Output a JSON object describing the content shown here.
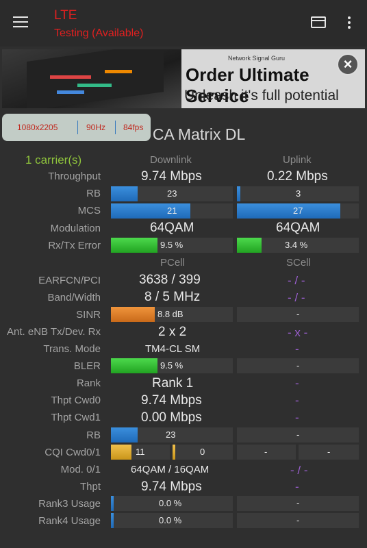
{
  "app": {
    "title": "LTE",
    "subtitle": "Testing (Available)"
  },
  "ad": {
    "brand": "Network Signal Guru",
    "headline": "Order Ultimate Service",
    "tagline": "Unleash it's full potential"
  },
  "overlay": {
    "resolution": "1080x2205",
    "refresh": "90Hz",
    "fps": "84fps"
  },
  "section_title": "LTE CA Matrix DL",
  "carriers": "1 carrier(s)",
  "headers": {
    "downlink": "Downlink",
    "uplink": "Uplink",
    "pcell": "PCell",
    "scell": "SCell"
  },
  "labels": {
    "throughput": "Throughput",
    "rb": "RB",
    "mcs": "MCS",
    "modulation": "Modulation",
    "error": "Rx/Tx Error",
    "earfcn": "EARFCN/PCI",
    "band": "Band/Width",
    "sinr": "SINR",
    "ant": "Ant. eNB Tx/Dev. Rx",
    "trans": "Trans. Mode",
    "bler": "BLER",
    "rank": "Rank",
    "cwd0": "Thpt Cwd0",
    "cwd1": "Thpt Cwd1",
    "rb2": "RB",
    "cqi": "CQI Cwd0/1",
    "mod01": "Mod. 0/1",
    "thpt": "Thpt",
    "rank3": "Rank3 Usage",
    "rank4": "Rank4 Usage"
  },
  "downlink": {
    "throughput": "9.74 Mbps",
    "rb": "23",
    "mcs": "21",
    "modulation": "64QAM",
    "error": "9.5 %"
  },
  "uplink": {
    "throughput": "0.22 Mbps",
    "rb": "3",
    "mcs": "27",
    "modulation": "64QAM",
    "error": "3.4 %"
  },
  "pcell": {
    "earfcn": "3638 / 399",
    "band": "8 / 5 MHz",
    "sinr": "8.8 dB",
    "ant": "2 x 2",
    "trans": "TM4-CL SM",
    "bler": "9.5 %",
    "rank": "Rank 1",
    "cwd0": "9.74 Mbps",
    "cwd1": "0.00 Mbps",
    "rb": "23",
    "cqi0": "11",
    "cqi1": "0",
    "mod01": "64QAM / 16QAM",
    "thpt": "9.74 Mbps",
    "rank3": "0.0 %",
    "rank4": "0.0 %"
  },
  "scell": {
    "earfcn": "- / -",
    "band": "- / -",
    "sinr": "-",
    "ant": "- x -",
    "trans": "-",
    "bler": "-",
    "rank": "-",
    "cwd0": "-",
    "cwd1": "-",
    "rb": "-",
    "cqi0": "-",
    "cqi1": "-",
    "mod01": "- / -",
    "thpt": "-",
    "rank3": "-",
    "rank4": "-"
  },
  "levels": {
    "dl_rb": 0.22,
    "ul_rb": 0.03,
    "dl_mcs": 0.65,
    "ul_mcs": 0.85,
    "dl_error": 0.38,
    "ul_error": 0.2,
    "sinr": 0.36,
    "bler": 0.38,
    "rb2": 0.22,
    "cqi0": 0.18,
    "cqi1": 0.02,
    "rank3": 0.02,
    "rank4": 0.02
  },
  "colors": {
    "title_red": "#e02020",
    "carrier_green": "#8fc43c",
    "accent_purple": "#9b5fd0",
    "bar_blue": "#2a7bc8",
    "bar_green": "#3cc83c",
    "bar_orange": "#e07e2a"
  }
}
